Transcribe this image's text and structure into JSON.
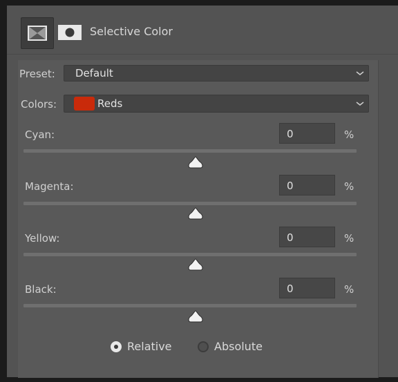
{
  "header": {
    "title": "Selective Color",
    "icons": [
      "adjustment-layer-icon",
      "layer-mask-icon"
    ]
  },
  "preset": {
    "label": "Preset:",
    "value": "Default"
  },
  "colors": {
    "label": "Colors:",
    "value": "Reds",
    "swatch_color": "#c92a0a"
  },
  "sliders": [
    {
      "label": "Cyan:",
      "value": "0",
      "unit": "%",
      "level": 0
    },
    {
      "label": "Magenta:",
      "value": "0",
      "unit": "%",
      "level": 0
    },
    {
      "label": "Yellow:",
      "value": "0",
      "unit": "%",
      "level": 0
    },
    {
      "label": "Black:",
      "value": "0",
      "unit": "%",
      "level": 0
    }
  ],
  "method": {
    "relative_label": "Relative",
    "absolute_label": "Absolute",
    "selected": "Relative"
  }
}
